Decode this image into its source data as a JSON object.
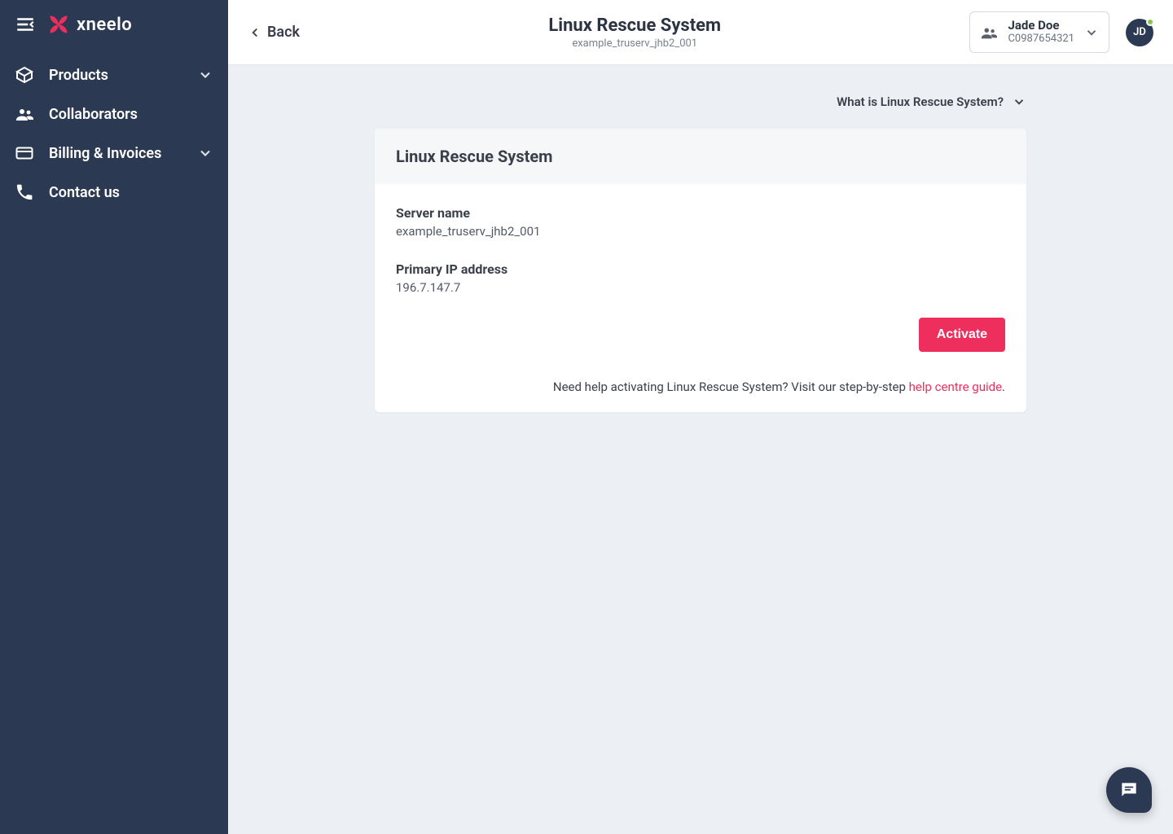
{
  "brand": {
    "name": "xneelo"
  },
  "sidebar": {
    "items": [
      {
        "label": "Products",
        "icon": "box",
        "expandable": true
      },
      {
        "label": "Collaborators",
        "icon": "people",
        "expandable": false
      },
      {
        "label": "Billing & Invoices",
        "icon": "card",
        "expandable": true
      },
      {
        "label": "Contact us",
        "icon": "phone",
        "expandable": false
      }
    ]
  },
  "header": {
    "back_label": "Back",
    "title": "Linux Rescue System",
    "subtitle": "example_truserv_jhb2_001",
    "account": {
      "name": "Jade Doe",
      "code": "C0987654321"
    },
    "avatar_initials": "JD"
  },
  "info_panel": {
    "toggle_label": "What is Linux Rescue System?"
  },
  "card": {
    "title": "Linux Rescue System",
    "fields": {
      "server_name_label": "Server name",
      "server_name_value": "example_truserv_jhb2_001",
      "ip_label": "Primary IP address",
      "ip_value": "196.7.147.7"
    },
    "activate_label": "Activate",
    "help_text_prefix": "Need help activating Linux Rescue System? Visit our step-by-step ",
    "help_link_label": "help centre guide",
    "help_text_suffix": "."
  }
}
